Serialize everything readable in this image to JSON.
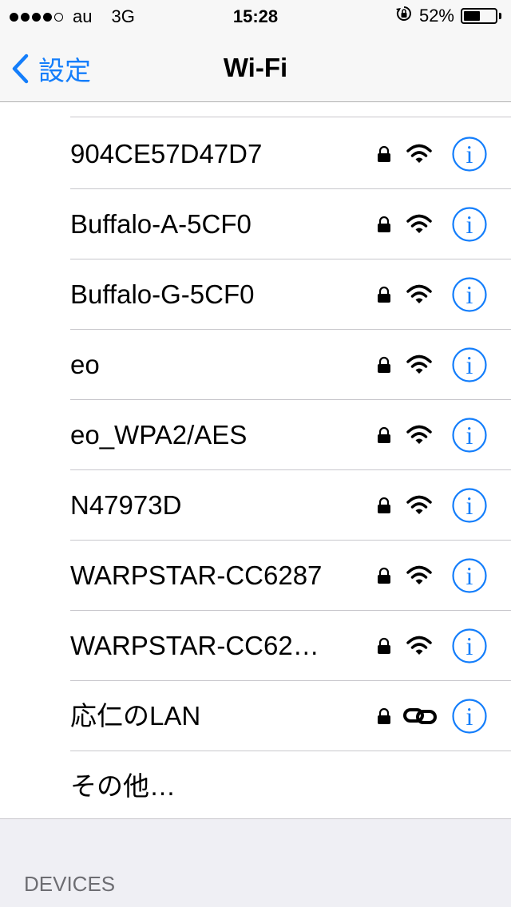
{
  "status_bar": {
    "signal_dots_filled": 4,
    "signal_dots_total": 5,
    "carrier": "au",
    "network": "3G",
    "time": "15:28",
    "battery_percent": "52%",
    "battery_level": 0.52
  },
  "nav": {
    "back_label": "設定",
    "title": "Wi-Fi"
  },
  "networks": [
    {
      "name": "904CE57D47D7",
      "secured": true,
      "signal_icon": "wifi-icon"
    },
    {
      "name": "Buffalo-A-5CF0",
      "secured": true,
      "signal_icon": "wifi-icon"
    },
    {
      "name": "Buffalo-G-5CF0",
      "secured": true,
      "signal_icon": "wifi-icon"
    },
    {
      "name": "eo",
      "secured": true,
      "signal_icon": "wifi-icon"
    },
    {
      "name": "eo_WPA2/AES",
      "secured": true,
      "signal_icon": "wifi-icon"
    },
    {
      "name": "N47973D",
      "secured": true,
      "signal_icon": "wifi-icon"
    },
    {
      "name": "WARPSTAR-CC6287",
      "secured": true,
      "signal_icon": "wifi-icon"
    },
    {
      "name": "WARPSTAR-CC62…",
      "secured": true,
      "signal_icon": "wifi-icon"
    },
    {
      "name": "応仁のLAN",
      "secured": true,
      "signal_icon": "link-icon"
    }
  ],
  "other_label": "その他…",
  "section_header": "DEVICES",
  "colors": {
    "accent": "#147efb",
    "background": "#efeff4",
    "separator": "#c8c7cc"
  }
}
